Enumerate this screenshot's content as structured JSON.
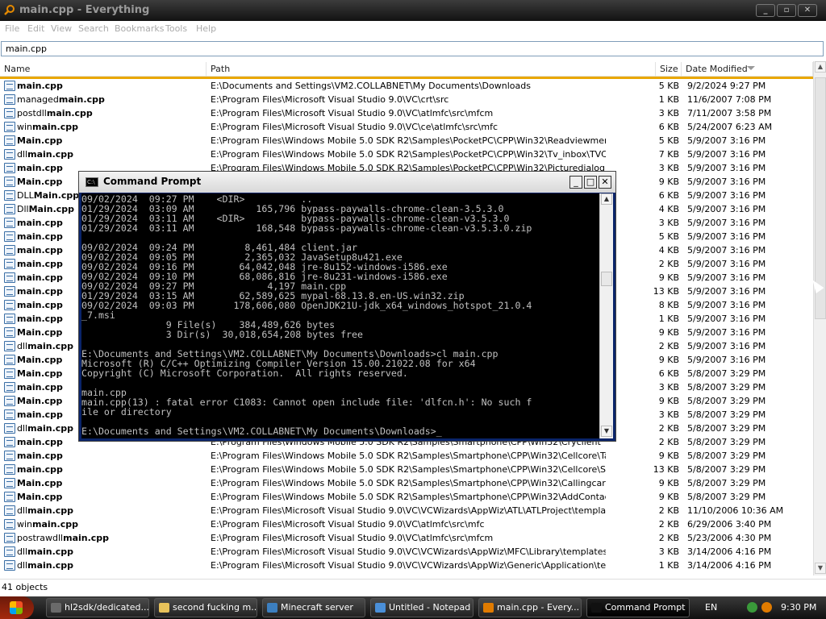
{
  "window": {
    "title": "main.cpp - Everything",
    "min": "_",
    "max": "▫",
    "close": "✕"
  },
  "menu": [
    "File",
    "Edit",
    "View",
    "Search",
    "Bookmarks",
    "Tools",
    "Help"
  ],
  "search": {
    "value": "main.cpp"
  },
  "columns": {
    "name": "Name",
    "path": "Path",
    "size": "Size",
    "date": "Date Modified"
  },
  "rows": [
    {
      "pre": "",
      "bold": "main.cpp",
      "post": "",
      "path": "E:\\Documents and Settings\\VM2.COLLABNET\\My Documents\\Downloads",
      "size": "5 KB",
      "date": "9/2/2024 9:27 PM"
    },
    {
      "pre": "managed",
      "bold": "main.cpp",
      "post": "",
      "path": "E:\\Program Files\\Microsoft Visual Studio 9.0\\VC\\crt\\src",
      "size": "1 KB",
      "date": "11/6/2007 7:08 PM"
    },
    {
      "pre": "postdll",
      "bold": "main.cpp",
      "post": "",
      "path": "E:\\Program Files\\Microsoft Visual Studio 9.0\\VC\\atlmfc\\src\\mfcm",
      "size": "3 KB",
      "date": "7/11/2007 3:58 PM"
    },
    {
      "pre": "win",
      "bold": "main.cpp",
      "post": "",
      "path": "E:\\Program Files\\Microsoft Visual Studio 9.0\\VC\\ce\\atlmfc\\src\\mfc",
      "size": "6 KB",
      "date": "5/24/2007 6:23 AM"
    },
    {
      "pre": "",
      "bold": "Main.cpp",
      "post": "",
      "path": "E:\\Program Files\\Windows Mobile 5.0 SDK R2\\Samples\\PocketPC\\CPP\\Win32\\Readviewmenuext\\Re...",
      "size": "5 KB",
      "date": "5/9/2007 3:16 PM"
    },
    {
      "pre": "dll",
      "bold": "main.cpp",
      "post": "",
      "path": "E:\\Program Files\\Windows Mobile 5.0 SDK R2\\Samples\\PocketPC\\CPP\\Win32\\Tv_inbox\\TVCustomF...",
      "size": "7 KB",
      "date": "5/9/2007 3:16 PM"
    },
    {
      "pre": "",
      "bold": "main.cpp",
      "post": "",
      "path": "E:\\Program Files\\Windows Mobile 5.0 SDK R2\\Samples\\PocketPC\\CPP\\Win32\\Picturedialog",
      "size": "3 KB",
      "date": "5/9/2007 3:16 PM"
    },
    {
      "pre": "",
      "bold": "Main.cpp",
      "post": "",
      "path": "",
      "size": "9 KB",
      "date": "5/9/2007 3:16 PM"
    },
    {
      "pre": "DLL",
      "bold": "Main.cpp",
      "post": "",
      "path": "",
      "size": "6 KB",
      "date": "5/9/2007 3:16 PM"
    },
    {
      "pre": "Dll",
      "bold": "Main.cpp",
      "post": "",
      "path": "",
      "size": "4 KB",
      "date": "5/9/2007 3:16 PM"
    },
    {
      "pre": "",
      "bold": "main.cpp",
      "post": "",
      "path": "",
      "size": "3 KB",
      "date": "5/9/2007 3:16 PM"
    },
    {
      "pre": "",
      "bold": "main.cpp",
      "post": "",
      "path": "",
      "size": "5 KB",
      "date": "5/9/2007 3:16 PM"
    },
    {
      "pre": "",
      "bold": "main.cpp",
      "post": "",
      "path": "",
      "size": "4 KB",
      "date": "5/9/2007 3:16 PM"
    },
    {
      "pre": "",
      "bold": "main.cpp",
      "post": "",
      "path": "",
      "size": "2 KB",
      "date": "5/9/2007 3:16 PM"
    },
    {
      "pre": "",
      "bold": "main.cpp",
      "post": "",
      "path": "",
      "size": "9 KB",
      "date": "5/9/2007 3:16 PM"
    },
    {
      "pre": "",
      "bold": "main.cpp",
      "post": "",
      "path": "",
      "size": "13 KB",
      "date": "5/9/2007 3:16 PM"
    },
    {
      "pre": "",
      "bold": "main.cpp",
      "post": "",
      "path": "",
      "size": "8 KB",
      "date": "5/9/2007 3:16 PM"
    },
    {
      "pre": "",
      "bold": "main.cpp",
      "post": "",
      "path": "",
      "size": "1 KB",
      "date": "5/9/2007 3:16 PM"
    },
    {
      "pre": "",
      "bold": "Main.cpp",
      "post": "",
      "path": "",
      "size": "9 KB",
      "date": "5/9/2007 3:16 PM"
    },
    {
      "pre": "dll",
      "bold": "main.cpp",
      "post": "",
      "path": "",
      "size": "2 KB",
      "date": "5/9/2007 3:16 PM"
    },
    {
      "pre": "",
      "bold": "Main.cpp",
      "post": "",
      "path": "",
      "size": "9 KB",
      "date": "5/9/2007 3:16 PM"
    },
    {
      "pre": "",
      "bold": "Main.cpp",
      "post": "",
      "path": "",
      "size": "6 KB",
      "date": "5/8/2007 3:29 PM"
    },
    {
      "pre": "",
      "bold": "main.cpp",
      "post": "",
      "path": "",
      "size": "3 KB",
      "date": "5/8/2007 3:29 PM"
    },
    {
      "pre": "",
      "bold": "Main.cpp",
      "post": "",
      "path": "",
      "size": "9 KB",
      "date": "5/8/2007 3:29 PM"
    },
    {
      "pre": "",
      "bold": "main.cpp",
      "post": "",
      "path": "",
      "size": "3 KB",
      "date": "5/8/2007 3:29 PM"
    },
    {
      "pre": "dll",
      "bold": "main.cpp",
      "post": "",
      "path": "",
      "size": "2 KB",
      "date": "5/8/2007 3:29 PM"
    },
    {
      "pre": "",
      "bold": "main.cpp",
      "post": "",
      "path": "E:\\Program Files\\Windows Mobile 5.0 SDK R2\\Samples\\Smartphone\\CPP\\Win32\\Cryclient",
      "size": "2 KB",
      "date": "5/8/2007 3:29 PM"
    },
    {
      "pre": "",
      "bold": "main.cpp",
      "post": "",
      "path": "E:\\Program Files\\Windows Mobile 5.0 SDK R2\\Samples\\Smartphone\\CPP\\Win32\\Cellcore\\Tapi\\Hello...",
      "size": "9 KB",
      "date": "5/8/2007 3:29 PM"
    },
    {
      "pre": "",
      "bold": "main.cpp",
      "post": "",
      "path": "E:\\Program Files\\Windows Mobile 5.0 SDK R2\\Samples\\Smartphone\\CPP\\Win32\\Cellcore\\Sms\\Hello...",
      "size": "13 KB",
      "date": "5/8/2007 3:29 PM"
    },
    {
      "pre": "",
      "bold": "Main.cpp",
      "post": "",
      "path": "E:\\Program Files\\Windows Mobile 5.0 SDK R2\\Samples\\Smartphone\\CPP\\Win32\\Callingcard",
      "size": "9 KB",
      "date": "5/8/2007 3:29 PM"
    },
    {
      "pre": "",
      "bold": "Main.cpp",
      "post": "",
      "path": "E:\\Program Files\\Windows Mobile 5.0 SDK R2\\Samples\\Smartphone\\CPP\\Win32\\AddContactPicture",
      "size": "9 KB",
      "date": "5/8/2007 3:29 PM"
    },
    {
      "pre": "dll",
      "bold": "main.cpp",
      "post": "",
      "path": "E:\\Program Files\\Microsoft Visual Studio 9.0\\VC\\VCWizards\\AppWiz\\ATL\\ATLProject\\templates\\1033",
      "size": "2 KB",
      "date": "11/10/2006 10:36 AM"
    },
    {
      "pre": "win",
      "bold": "main.cpp",
      "post": "",
      "path": "E:\\Program Files\\Microsoft Visual Studio 9.0\\VC\\atlmfc\\src\\mfc",
      "size": "2 KB",
      "date": "6/29/2006 3:40 PM"
    },
    {
      "pre": "postrawdll",
      "bold": "main.cpp",
      "post": "",
      "path": "E:\\Program Files\\Microsoft Visual Studio 9.0\\VC\\atlmfc\\src\\mfcm",
      "size": "2 KB",
      "date": "5/23/2006 4:30 PM"
    },
    {
      "pre": "dll",
      "bold": "main.cpp",
      "post": "",
      "path": "E:\\Program Files\\Microsoft Visual Studio 9.0\\VC\\VCWizards\\AppWiz\\MFC\\Library\\templates\\1033",
      "size": "3 KB",
      "date": "3/14/2006 4:16 PM"
    },
    {
      "pre": "dll",
      "bold": "main.cpp",
      "post": "",
      "path": "E:\\Program Files\\Microsoft Visual Studio 9.0\\VC\\VCWizards\\AppWiz\\Generic\\Application\\templates\\...",
      "size": "1 KB",
      "date": "3/14/2006 4:16 PM"
    }
  ],
  "status": "41 objects",
  "cmd": {
    "title": "Command Prompt",
    "icon_text": "C:\\",
    "lines": [
      "09/02/2024  09:27 PM    <DIR>          ..",
      "01/29/2024  03:09 AM           165,796 bypass-paywalls-chrome-clean-3.5.3.0",
      "01/29/2024  03:11 AM    <DIR>          bypass-paywalls-chrome-clean-v3.5.3.0",
      "01/29/2024  03:11 AM           168,548 bypass-paywalls-chrome-clean-v3.5.3.0.zip",
      "",
      "09/02/2024  09:24 PM         8,461,484 client.jar",
      "09/02/2024  09:05 PM         2,365,032 JavaSetup8u421.exe",
      "09/02/2024  09:16 PM        64,042,048 jre-8u152-windows-i586.exe",
      "09/02/2024  09:10 PM        68,086,816 jre-8u231-windows-i586.exe",
      "09/02/2024  09:27 PM             4,197 main.cpp",
      "01/29/2024  03:15 AM        62,589,625 mypal-68.13.8.en-US.win32.zip",
      "09/02/2024  09:03 PM       178,606,080 OpenJDK21U-jdk_x64_windows_hotspot_21.0.4",
      "_7.msi",
      "               9 File(s)    384,489,626 bytes",
      "               3 Dir(s)  30,018,654,208 bytes free",
      "",
      "E:\\Documents and Settings\\VM2.COLLABNET\\My Documents\\Downloads>cl main.cpp",
      "Microsoft (R) C/C++ Optimizing Compiler Version 15.00.21022.08 for x64",
      "Copyright (C) Microsoft Corporation.  All rights reserved.",
      "",
      "main.cpp",
      "main.cpp(13) : fatal error C1083: Cannot open include file: 'dlfcn.h': No such f",
      "ile or directory",
      "",
      "E:\\Documents and Settings\\VM2.COLLABNET\\My Documents\\Downloads>_"
    ]
  },
  "taskbar": {
    "tasks": [
      {
        "label": "hl2sdk/dedicated...",
        "color": "#6a6a6a"
      },
      {
        "label": "second fucking m...",
        "color": "#e8c25a"
      },
      {
        "label": "Minecraft server",
        "color": "#3c7fc0"
      },
      {
        "label": "Untitled - Notepad",
        "color": "#4a8fd8"
      },
      {
        "label": "main.cpp - Every...",
        "color": "#e07b00"
      },
      {
        "label": "Command Prompt",
        "color": "#111111"
      }
    ],
    "lang": "EN",
    "clock": "9:30 PM"
  },
  "colors": {
    "accent": "#e9a700",
    "taskbar": "#1a1a1a",
    "console_bg": "#000000",
    "console_fg": "#c0c0c0"
  }
}
